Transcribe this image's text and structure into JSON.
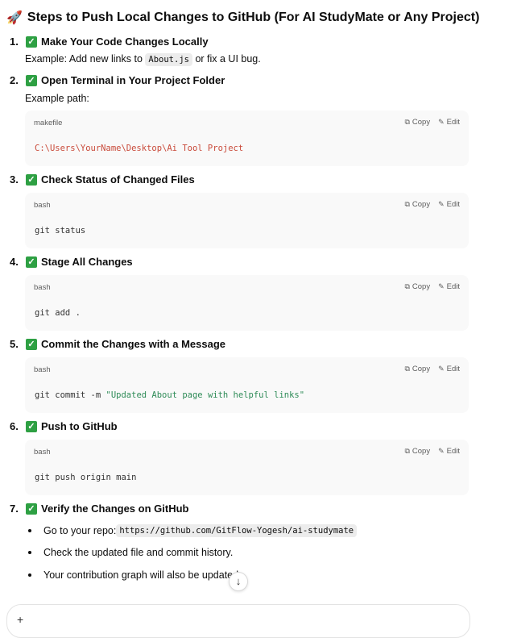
{
  "title": {
    "icon": "rocket-icon",
    "text": "Steps to Push Local Changes to GitHub (For AI StudyMate or Any Project)"
  },
  "actions": {
    "copy": "Copy",
    "edit": "Edit"
  },
  "steps": [
    {
      "num": "1.",
      "label": "Make Your Code Changes Locally",
      "desc_pre": "Example: Add new links to ",
      "desc_code": "About.js",
      "desc_post": " or fix a UI bug."
    },
    {
      "num": "2.",
      "label": "Open Terminal in Your Project Folder",
      "desc": "Example path:",
      "code_lang": "makefile",
      "code": "C:\\Users\\YourName\\Desktop\\Ai Tool Project"
    },
    {
      "num": "3.",
      "label": "Check Status of Changed Files",
      "code_lang": "bash",
      "code": "git status"
    },
    {
      "num": "4.",
      "label": "Stage All Changes",
      "code_lang": "bash",
      "code": "git add ."
    },
    {
      "num": "5.",
      "label": "Commit the Changes with a Message",
      "code_lang": "bash",
      "code_cmd": "git commit -m ",
      "code_str": "\"Updated About page with helpful links\""
    },
    {
      "num": "6.",
      "label": "Push to GitHub",
      "code_lang": "bash",
      "code": "git push origin main"
    },
    {
      "num": "7.",
      "label": "Verify the Changes on GitHub",
      "bullets": [
        {
          "pre": "Go to your repo: ",
          "code": "https://github.com/GitFlow-Yogesh/ai-studymate"
        },
        {
          "text": "Check the updated file and commit history."
        },
        {
          "text": "Your contribution graph will also be updated"
        }
      ]
    }
  ],
  "scroll_button": {
    "icon": "arrow-down-icon",
    "glyph": "↓"
  },
  "composer": {
    "plus": "+"
  }
}
